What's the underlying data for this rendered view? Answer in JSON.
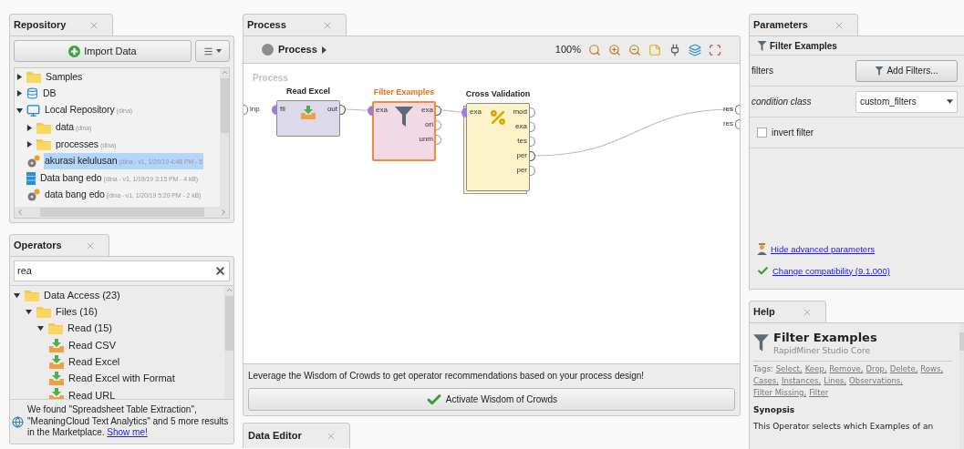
{
  "repository": {
    "tab": "Repository",
    "import_button": "Import Data",
    "items": [
      {
        "label": "Samples",
        "kind": "folder",
        "expanded": false,
        "selected": false
      },
      {
        "label": "DB",
        "kind": "database",
        "expanded": false,
        "selected": false
      },
      {
        "label": "Local Repository",
        "meta": "(dina)",
        "kind": "repository",
        "expanded": true,
        "selected": false,
        "children": [
          {
            "label": "data",
            "meta": "(dina)",
            "kind": "folder",
            "expanded": false,
            "selected": false
          },
          {
            "label": "processes",
            "meta": "(dina)",
            "kind": "folder",
            "expanded": false,
            "selected": false
          },
          {
            "label": "akurasi kelulusan",
            "meta": "(dina - v1, 1/20/19 4:48 PM - 5",
            "kind": "process",
            "selected": true
          },
          {
            "label": "Data bang edo",
            "meta": "(dina - v1, 1/18/19 3:15 PM - 4 kB)",
            "kind": "data",
            "selected": false
          },
          {
            "label": "data bang edo",
            "meta": "(dina - v1, 1/20/19 5:20 PM - 2 kB)",
            "kind": "process",
            "selected": false
          }
        ]
      }
    ]
  },
  "operators": {
    "tab": "Operators",
    "search": {
      "value": "rea"
    },
    "items": [
      {
        "label": "Data Access (23)",
        "kind": "folder",
        "expanded": true,
        "children": [
          {
            "label": "Files (16)",
            "kind": "folder",
            "expanded": true,
            "children": [
              {
                "label": "Read (15)",
                "kind": "folder",
                "expanded": true,
                "children": [
                  {
                    "label": "Read CSV",
                    "kind": "operator"
                  },
                  {
                    "label": "Read Excel",
                    "kind": "operator"
                  },
                  {
                    "label": "Read Excel with Format",
                    "kind": "operator"
                  },
                  {
                    "label": "Read URL",
                    "kind": "operator"
                  }
                ]
              }
            ]
          }
        ]
      }
    ],
    "marketplace_notice": {
      "text": "We found \"Spreadsheet Table Extraction\", \"MeaningCloud Text Analytics\" and 5 more results in the Marketplace.",
      "link": "Show me!"
    }
  },
  "process": {
    "tab": "Process",
    "breadcrumb": "Process",
    "zoom": "100%",
    "canvas_label": "Process",
    "inputs": [
      "inp"
    ],
    "results": [
      "res",
      "res"
    ],
    "nodes": [
      {
        "name": "Read Excel",
        "kind": "operator",
        "color": "#dcd9ea",
        "selected": false,
        "in_ports": [
          "fil"
        ],
        "out_ports": [
          {
            "label": "out",
            "connected": true
          }
        ]
      },
      {
        "name": "Filter Examples",
        "kind": "operator",
        "color": "#f2d9e6",
        "selected": true,
        "in_ports": [
          "exa"
        ],
        "out_ports": [
          {
            "label": "exa",
            "connected": true
          },
          {
            "label": "ori",
            "connected": false
          },
          {
            "label": "unm",
            "connected": false
          }
        ]
      },
      {
        "name": "Cross Validation",
        "kind": "subprocess",
        "color": "#fdf3c9",
        "selected": false,
        "in_ports": [
          "exa"
        ],
        "out_ports": [
          {
            "label": "mod",
            "connected": false
          },
          {
            "label": "exa",
            "connected": false
          },
          {
            "label": "tes",
            "connected": false
          },
          {
            "label": "per",
            "connected": true
          },
          {
            "label": "per",
            "connected": false
          }
        ]
      }
    ],
    "wisdom_text": "Leverage the Wisdom of Crowds to get operator recommendations based on your process design!",
    "wisdom_button": "Activate Wisdom of Crowds"
  },
  "data_editor": {
    "tab": "Data Editor"
  },
  "parameters": {
    "tab": "Parameters",
    "operator": "Filter Examples",
    "params": [
      {
        "kind": "button",
        "label": "filters",
        "value": "Add Filters...",
        "expert": false
      },
      {
        "kind": "select",
        "label": "condition class",
        "value": "custom_filters",
        "expert": true
      },
      {
        "kind": "checkbox",
        "label": "invert filter",
        "checked": false,
        "expert": false
      }
    ],
    "links": [
      {
        "kind": "advanced",
        "text": "Hide advanced parameters"
      },
      {
        "kind": "compatibility",
        "text": "Change compatibility (9.1.000)"
      }
    ]
  },
  "help": {
    "tab": "Help",
    "title": "Filter Examples",
    "subtitle": "RapidMiner Studio Core",
    "tags_label": "Tags:",
    "tags": [
      "Select,",
      "Keep,",
      "Remove,",
      "Drop,",
      "Delete,",
      "Rows,",
      "Cases,",
      "Instances,",
      "Lines,",
      "Observations,",
      "Filter Missing,",
      "Filter"
    ],
    "section": "Synopsis",
    "text": "This Operator selects which Examples of an"
  }
}
